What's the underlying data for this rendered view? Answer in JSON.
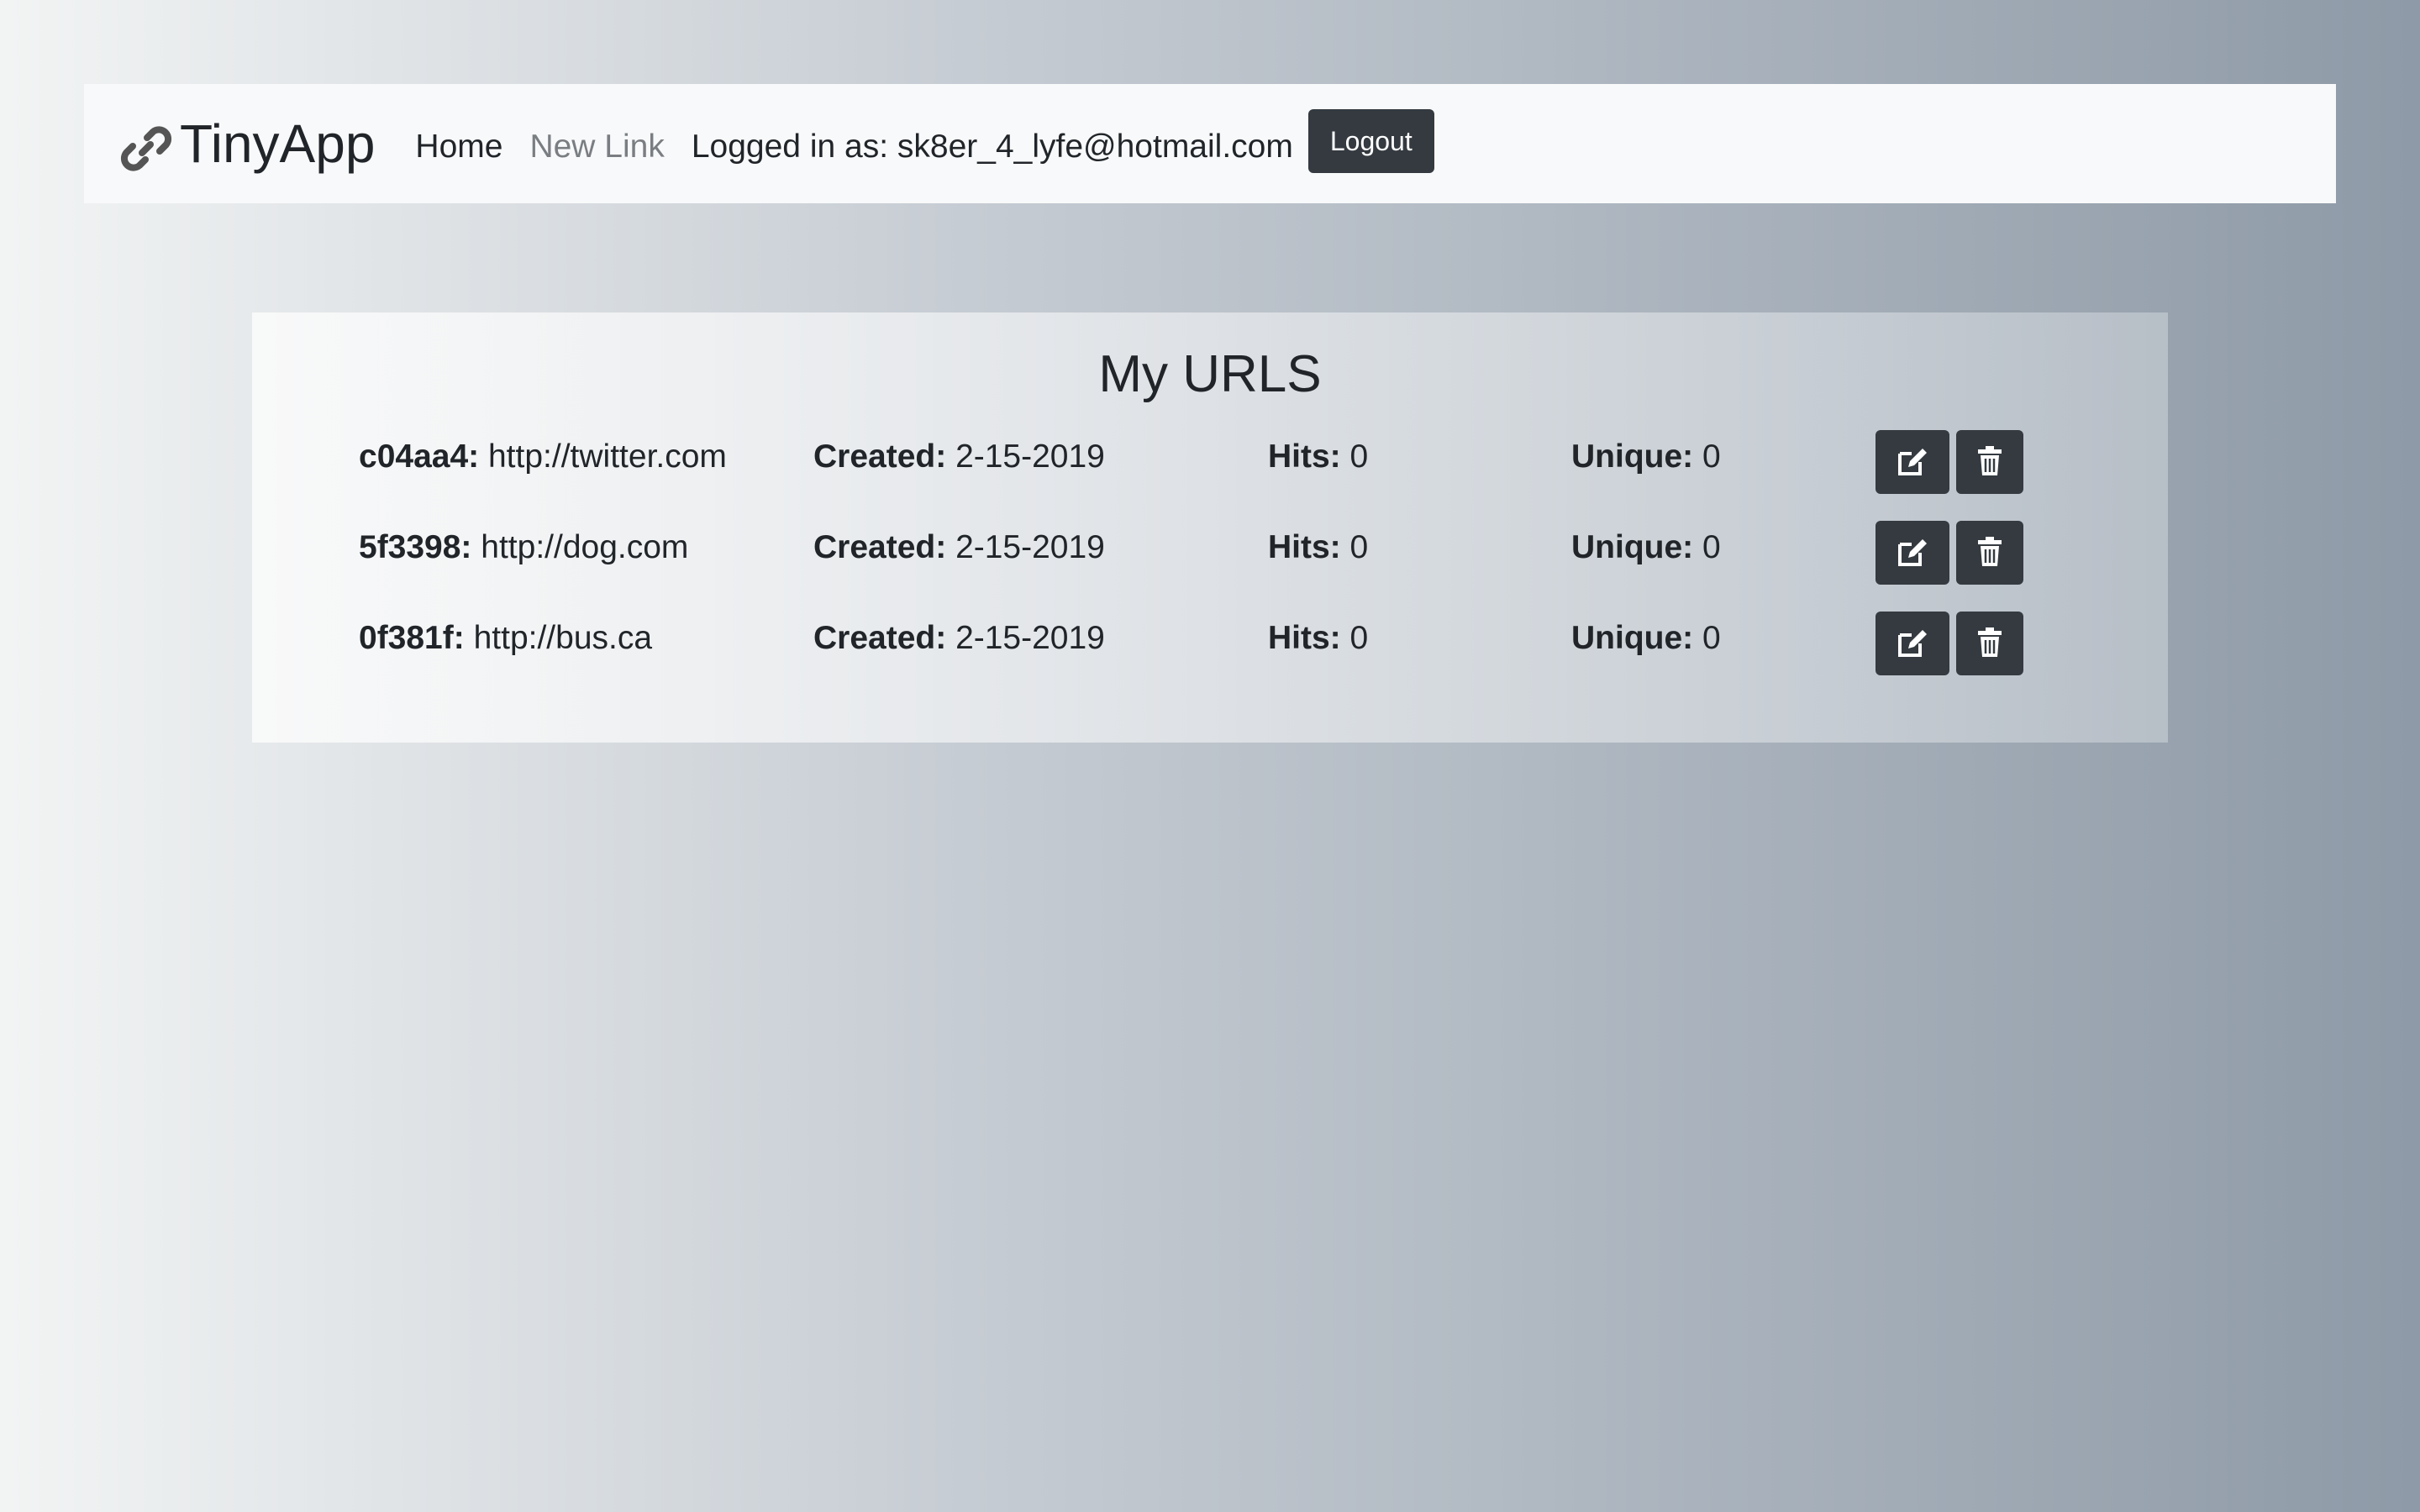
{
  "nav": {
    "brand": "TinyApp",
    "brand_icon": "link-icon",
    "links": [
      {
        "label": "Home"
      },
      {
        "label": "New Link"
      }
    ],
    "logged_in_text": "Logged in as: sk8er_4_lyfe@hotmail.com",
    "logout_label": "Logout"
  },
  "main": {
    "title": "My URLS",
    "created_label": "Created:",
    "hits_label": "Hits:",
    "unique_label": "Unique:",
    "edit_icon": "edit-icon",
    "delete_icon": "trash-icon",
    "urls": [
      {
        "id": "c04aa4:",
        "url": "http://twitter.com",
        "created": "2-15-2019",
        "hits": "0",
        "unique": "0"
      },
      {
        "id": "5f3398:",
        "url": "http://dog.com",
        "created": "2-15-2019",
        "hits": "0",
        "unique": "0"
      },
      {
        "id": "0f381f:",
        "url": "http://bus.ca",
        "created": "2-15-2019",
        "hits": "0",
        "unique": "0"
      }
    ]
  },
  "colors": {
    "navbar_bg": "#f8f9fa",
    "button_dark": "#343a40",
    "muted_link": "#7a7e82"
  }
}
